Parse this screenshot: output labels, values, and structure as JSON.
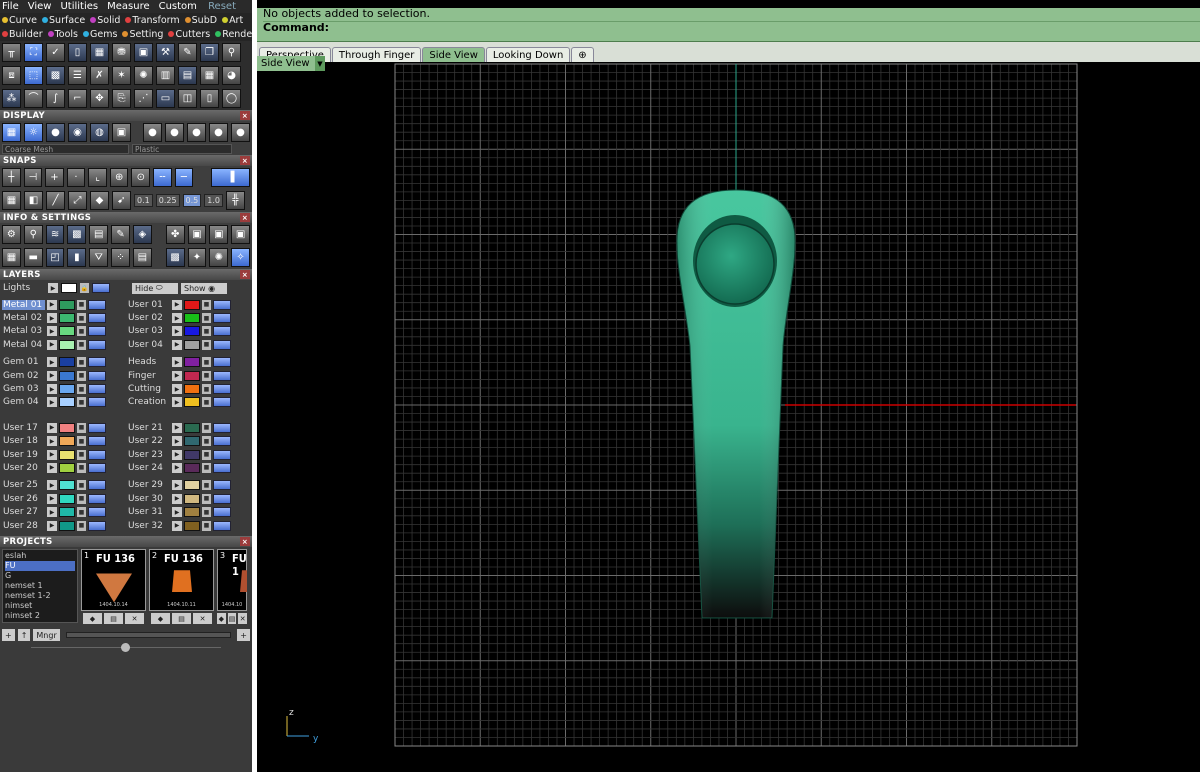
{
  "menu": {
    "items": [
      "File",
      "View",
      "Utilities",
      "Measure",
      "Custom"
    ],
    "reset": "Reset"
  },
  "tabs_row1": [
    {
      "label": "Curve",
      "color": "#e8c030"
    },
    {
      "label": "Surface",
      "color": "#30b0e0"
    },
    {
      "label": "Solid",
      "color": "#c040c0"
    },
    {
      "label": "Transform",
      "color": "#e04040"
    },
    {
      "label": "SubD",
      "color": "#e09030"
    },
    {
      "label": "Art",
      "color": "#d0d030"
    }
  ],
  "tabs_row2": [
    {
      "label": "Builder",
      "color": "#e04040"
    },
    {
      "label": "Tools",
      "color": "#c040c0"
    },
    {
      "label": "Gems",
      "color": "#30b0e0"
    },
    {
      "label": "Setting",
      "color": "#e09030"
    },
    {
      "label": "Cutters",
      "color": "#e04040"
    },
    {
      "label": "Render",
      "color": "#30c060"
    }
  ],
  "display": {
    "title": "DISPLAY",
    "mesh": "Coarse Mesh",
    "material": "Plastic"
  },
  "snaps": {
    "title": "SNAPS",
    "values": [
      "0.1",
      "0.25",
      "0.5",
      "1.0"
    ],
    "selected": "0.5"
  },
  "info": {
    "title": "INFO & SETTINGS"
  },
  "layers": {
    "title": "LAYERS",
    "lights": "Lights",
    "hide": "Hide",
    "show": "Show",
    "left_groups": [
      [
        {
          "name": "Metal 01",
          "color": "#2e9a5e",
          "sel": true
        },
        {
          "name": "Metal 02",
          "color": "#3cb870"
        },
        {
          "name": "Metal 03",
          "color": "#68d880"
        },
        {
          "name": "Metal 04",
          "color": "#a8f0b0"
        }
      ],
      [
        {
          "name": "Gem 01",
          "color": "#1a3fa0"
        },
        {
          "name": "Gem 02",
          "color": "#3a78d0"
        },
        {
          "name": "Gem 03",
          "color": "#6aa8f0"
        },
        {
          "name": "Gem 04",
          "color": "#a8d0ff"
        }
      ],
      [
        {
          "name": "User 17",
          "color": "#f08080"
        },
        {
          "name": "User 18",
          "color": "#f0a858"
        },
        {
          "name": "User 19",
          "color": "#e8e070"
        },
        {
          "name": "User 20",
          "color": "#a0d040"
        }
      ],
      [
        {
          "name": "User 25",
          "color": "#50e0d0"
        },
        {
          "name": "User 26",
          "color": "#30d8c0"
        },
        {
          "name": "User 27",
          "color": "#20b8a8"
        },
        {
          "name": "User 28",
          "color": "#109888"
        }
      ]
    ],
    "right_groups": [
      [
        {
          "name": "User 01",
          "color": "#e01818"
        },
        {
          "name": "User 02",
          "color": "#18c018"
        },
        {
          "name": "User 03",
          "color": "#1818e0"
        },
        {
          "name": "User 04",
          "color": "#a0a0a0"
        }
      ],
      [
        {
          "name": "Heads",
          "color": "#8020a0"
        },
        {
          "name": "Finger",
          "color": "#c02850"
        },
        {
          "name": "Cutting",
          "color": "#f07010"
        },
        {
          "name": "Creation",
          "color": "#f0c020"
        }
      ],
      [
        {
          "name": "User 21",
          "color": "#2a6a50"
        },
        {
          "name": "User 22",
          "color": "#306870"
        },
        {
          "name": "User 23",
          "color": "#403868"
        },
        {
          "name": "User 24",
          "color": "#5a2a5a"
        }
      ],
      [
        {
          "name": "User 29",
          "color": "#e0d0a0"
        },
        {
          "name": "User 30",
          "color": "#d0b880"
        },
        {
          "name": "User 31",
          "color": "#a08040"
        },
        {
          "name": "User 32",
          "color": "#806020"
        }
      ]
    ]
  },
  "projects": {
    "title": "PROJECTS",
    "list": [
      "eslah",
      "FU",
      "G",
      "nemset 1",
      "nemset 1-2",
      "nimset",
      "nimset 2"
    ],
    "selected": "FU",
    "thumbs": [
      {
        "num": "1",
        "title": "FU 136",
        "caption": "1404.10.14"
      },
      {
        "num": "2",
        "title": "FU 136",
        "caption": "1404.10.11"
      },
      {
        "num": "3",
        "title": "FU 1",
        "caption": "1404.10"
      }
    ],
    "mngr": "Mngr"
  },
  "command": {
    "line1": "No objects added to selection.",
    "line2": "Command:"
  },
  "view_tabs": [
    "Perspective",
    "Through Finger",
    "Side View",
    "Looking Down"
  ],
  "active_view_tab": "Side View",
  "view_label": "Side View",
  "axis": {
    "z": "z",
    "y": "y"
  }
}
